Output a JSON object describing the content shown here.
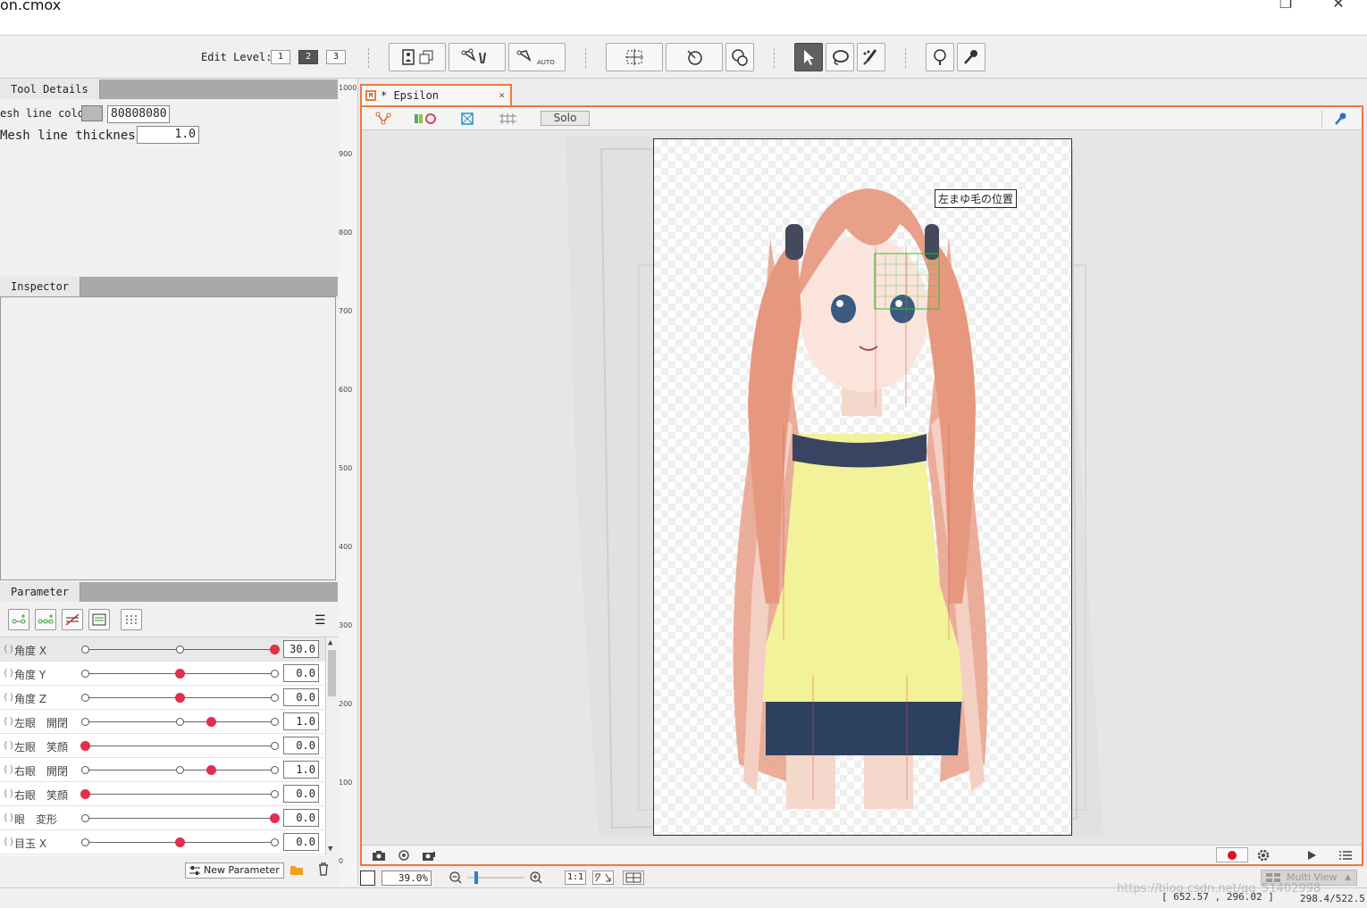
{
  "window": {
    "title": "on.cmox"
  },
  "toolbar": {
    "edit_level_label": "Edit Level:",
    "levels": [
      "1",
      "2",
      "3"
    ],
    "active_level": "2"
  },
  "tool_details": {
    "tab": "Tool Details",
    "mesh_line_color_label": "esh line color",
    "mesh_line_color_value": "80808080",
    "mesh_line_thickness_label": "Mesh line thickness",
    "mesh_line_thickness_value": "1.0",
    "colors": {
      "swatch": "#b8b8b8"
    }
  },
  "inspector": {
    "tab": "Inspector"
  },
  "parameter": {
    "tab": "Parameter",
    "new_parameter_label": "New Parameter",
    "items": [
      {
        "name": "角度 X",
        "value": "30.0",
        "pos": 1.0,
        "keys": [
          0,
          0.5,
          1
        ],
        "selected": true
      },
      {
        "name": "角度 Y",
        "value": "0.0",
        "pos": 0.5,
        "keys": [
          0,
          0.5,
          1
        ]
      },
      {
        "name": "角度 Z",
        "value": "0.0",
        "pos": 0.5,
        "keys": [
          0,
          0.5,
          1
        ]
      },
      {
        "name": "左眼　開閉",
        "value": "1.0",
        "pos": 0.667,
        "keys": [
          0,
          0.5,
          1
        ]
      },
      {
        "name": "左眼　笑顔",
        "value": "0.0",
        "pos": 0.0,
        "keys": [
          0,
          1
        ]
      },
      {
        "name": "右眼　開閉",
        "value": "1.0",
        "pos": 0.667,
        "keys": [
          0,
          0.5,
          1
        ]
      },
      {
        "name": "右眼　笑顔",
        "value": "0.0",
        "pos": 0.0,
        "keys": [
          0,
          1
        ]
      },
      {
        "name": "眼　変形",
        "value": "0.0",
        "pos": 1.0,
        "keys": [
          0,
          1
        ]
      },
      {
        "name": "目玉 X",
        "value": "0.0",
        "pos": 0.5,
        "keys": [
          0,
          0.5,
          1
        ]
      }
    ]
  },
  "ruler": {
    "ticks": [
      "1000",
      "900",
      "800",
      "700",
      "600",
      "500",
      "400",
      "300",
      "200",
      "100",
      "0"
    ]
  },
  "document": {
    "tab_name": "* Epsilon",
    "tab_close": "×",
    "solo_label": "Solo",
    "canvas_label": "左まゆ毛の位置"
  },
  "status": {
    "zoom": "39.0",
    "zoom_unit": "%",
    "ratio_label": "1:1",
    "multi_view": "Multi View",
    "coords": "[   652.57 ,   296.02  ]",
    "coords2": "298.4/522.5",
    "watermark": "https://blog.csdn.net/qq_51402998"
  },
  "colors": {
    "accent": "#f07840",
    "key_dot": "#e0304a",
    "toolbar_active": "#606060"
  }
}
